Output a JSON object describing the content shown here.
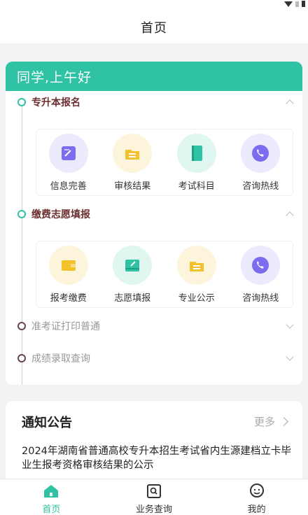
{
  "nav": {
    "title": "首页"
  },
  "greeting": "同学,上午好",
  "sections": [
    {
      "label": "专升本报名",
      "expanded": true,
      "items": [
        {
          "label": "信息完善",
          "icon": "edit-form-icon",
          "color": "#7b6cf0",
          "bg": "#ecebfd"
        },
        {
          "label": "审核结果",
          "icon": "folder-icon",
          "color": "#f3c12c",
          "bg": "#fdf4dc"
        },
        {
          "label": "考试科目",
          "icon": "book-icon",
          "color": "#2fc2a4",
          "bg": "#e0f6f1"
        },
        {
          "label": "咨询热线",
          "icon": "phone-icon",
          "color": "#7b6cf0",
          "bg": "#ecebfd"
        }
      ]
    },
    {
      "label": "缴费志愿填报",
      "expanded": true,
      "items": [
        {
          "label": "报考缴费",
          "icon": "wallet-icon",
          "color": "#f3c12c",
          "bg": "#fdf4dc"
        },
        {
          "label": "志愿填报",
          "icon": "inbox-edit-icon",
          "color": "#2fc2a4",
          "bg": "#e0f6f1"
        },
        {
          "label": "专业公示",
          "icon": "folder-icon",
          "color": "#f3c12c",
          "bg": "#fdf4dc"
        },
        {
          "label": "咨询热线",
          "icon": "phone-icon",
          "color": "#7b6cf0",
          "bg": "#ecebfd"
        }
      ]
    },
    {
      "label": "准考证打印普通",
      "expanded": false
    },
    {
      "label": "成绩录取查询",
      "expanded": false
    }
  ],
  "notice": {
    "title": "通知公告",
    "more": "更多",
    "text": "2024年湖南省普通高校专升本招生考试省内生源建档立卡毕业生报考资格审核结果的公示"
  },
  "tabbar": [
    {
      "label": "首页",
      "icon": "home-icon",
      "active": true
    },
    {
      "label": "业务查询",
      "icon": "search-box-icon",
      "active": false
    },
    {
      "label": "我的",
      "icon": "smiley-icon",
      "active": false
    }
  ],
  "colors": {
    "accent": "#2fc2a4",
    "section_text": "#6b2f2f"
  }
}
